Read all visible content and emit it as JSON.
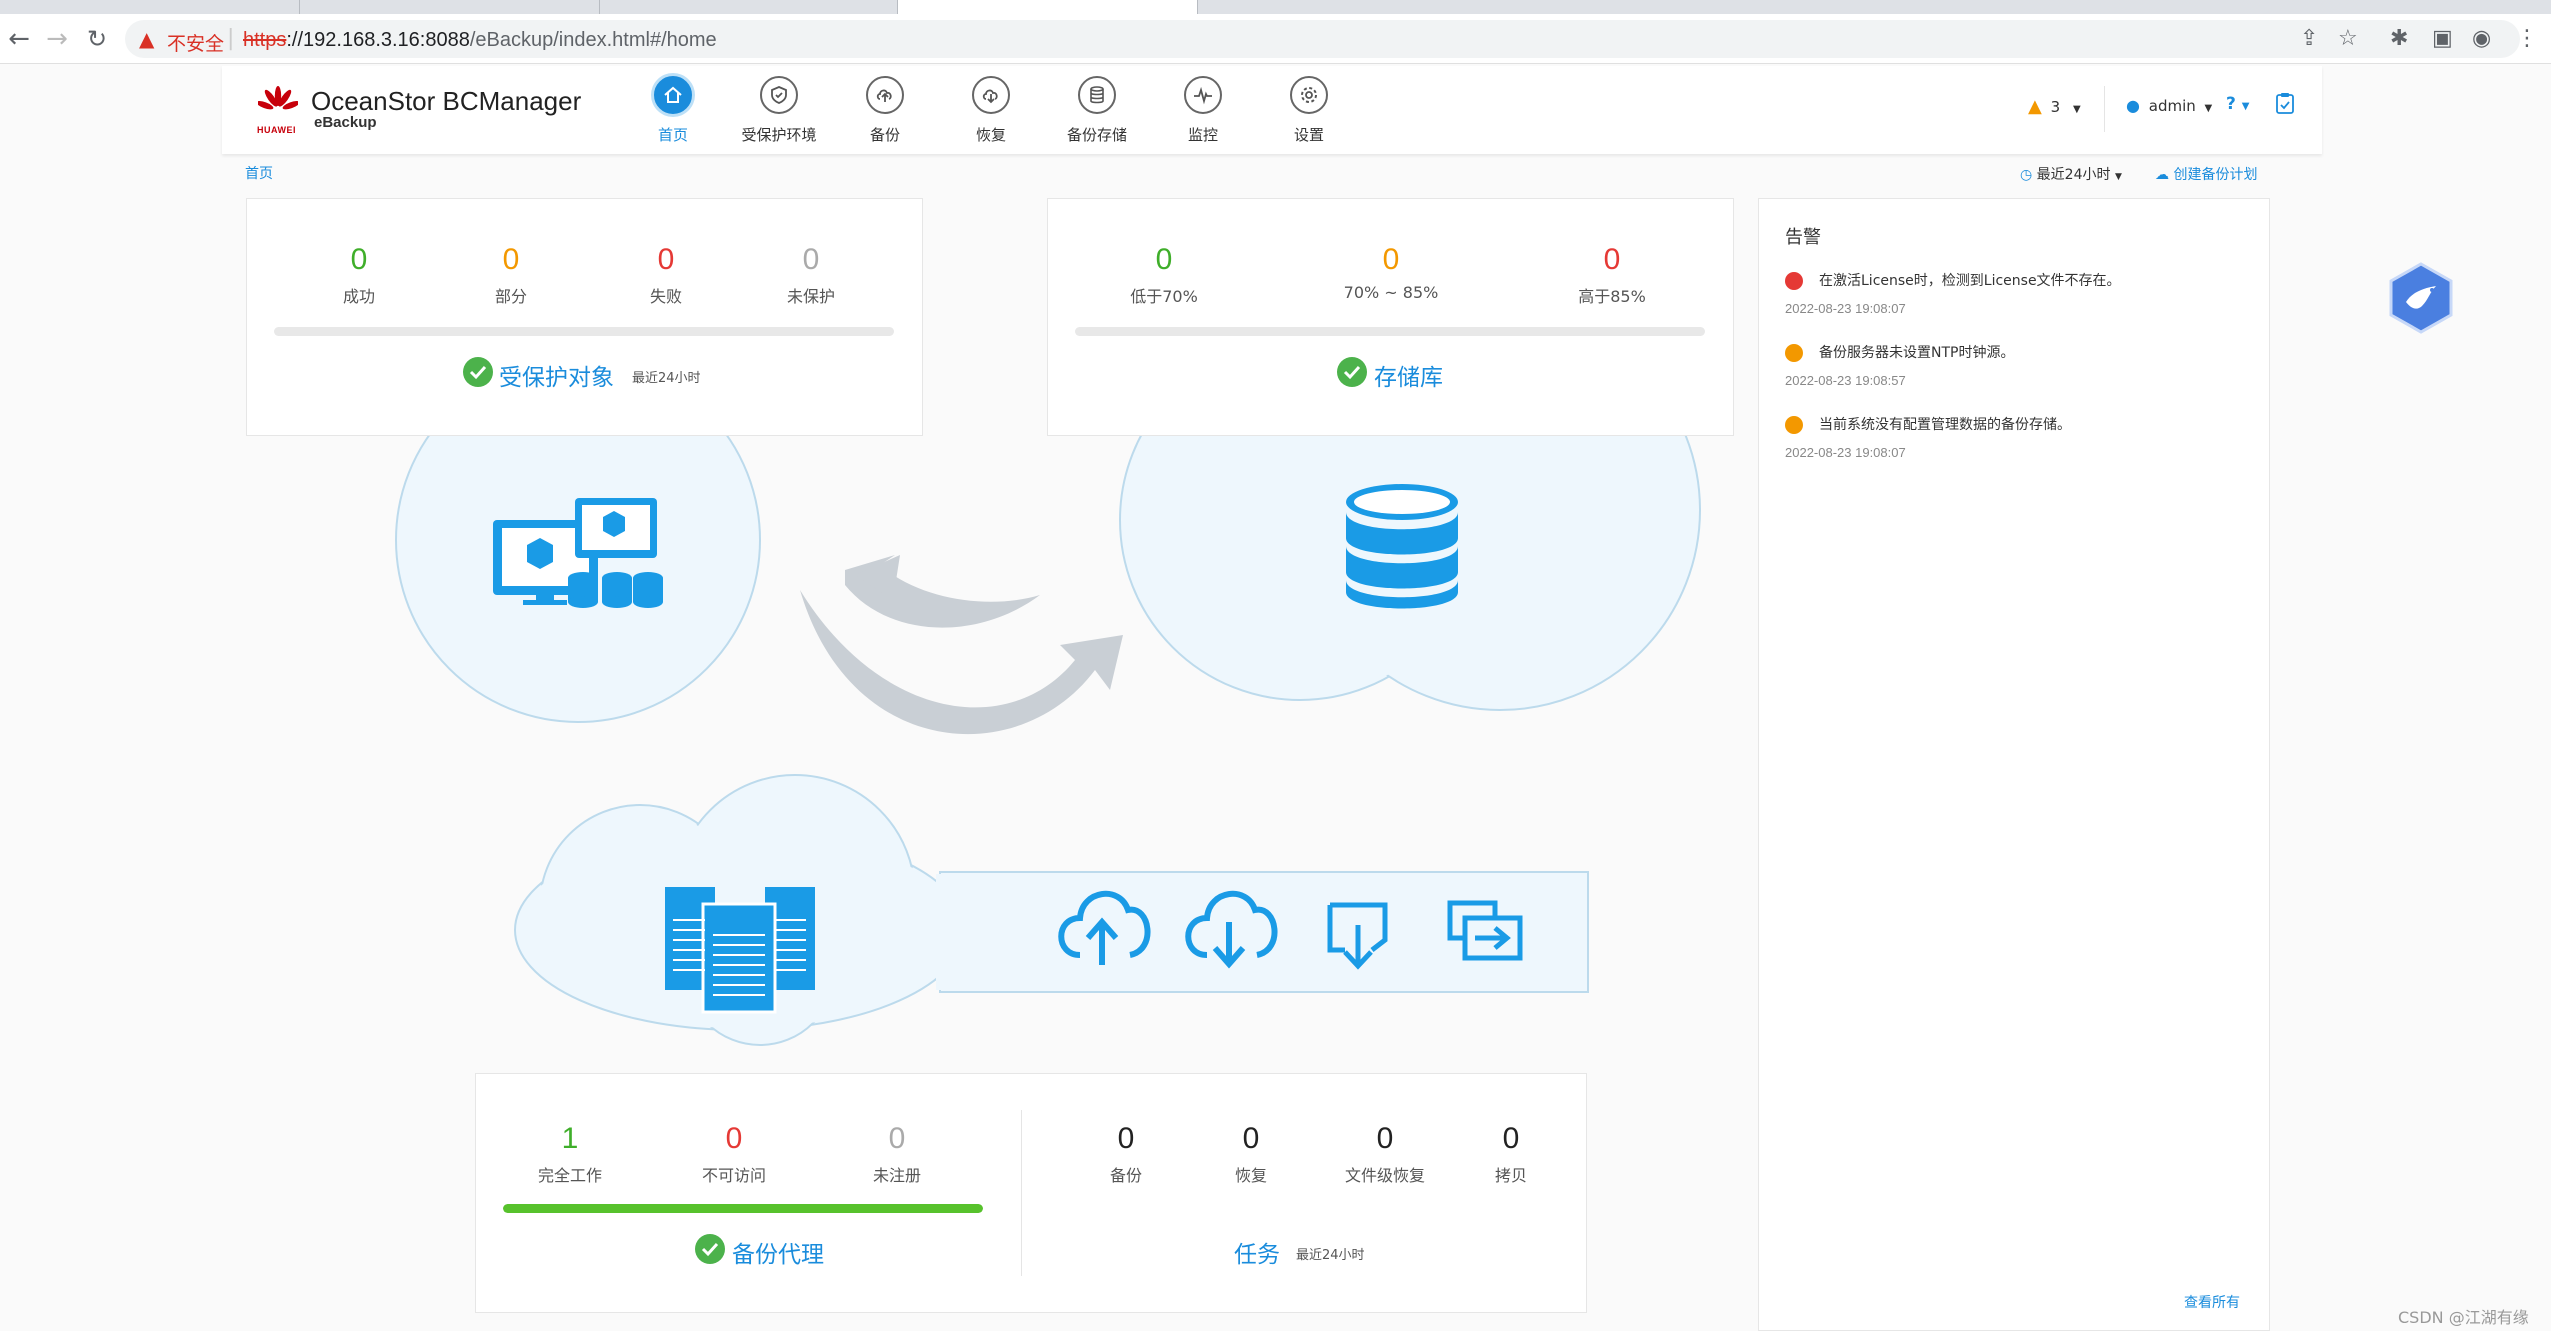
{
  "browser": {
    "insecure_label": "不安全",
    "url_scheme": "https",
    "url_host": "://192.168.3.16:8088",
    "url_path": "/eBackup/index.html#/home"
  },
  "app": {
    "brand": "HUAWEI",
    "title": "OceanStor BCManager",
    "subtitle": "eBackup"
  },
  "nav": [
    {
      "label": "首页",
      "icon": "home-icon",
      "active": true
    },
    {
      "label": "受保护环境",
      "icon": "shield-icon",
      "active": false
    },
    {
      "label": "备份",
      "icon": "cloud-upload-icon",
      "active": false
    },
    {
      "label": "恢复",
      "icon": "cloud-download-icon",
      "active": false
    },
    {
      "label": "备份存储",
      "icon": "database-icon",
      "active": false
    },
    {
      "label": "监控",
      "icon": "pulse-icon",
      "active": false
    },
    {
      "label": "设置",
      "icon": "gear-icon",
      "active": false
    }
  ],
  "header_right": {
    "alarm_count": "3",
    "user": "admin",
    "help": "?"
  },
  "breadcrumb": "首页",
  "time_filter": "最近24小时",
  "create_plan": "创建备份计划",
  "protected": {
    "stats": [
      {
        "value": "0",
        "label": "成功",
        "color": "#3fae2a"
      },
      {
        "value": "0",
        "label": "部分",
        "color": "#f39800"
      },
      {
        "value": "0",
        "label": "失败",
        "color": "#e53935"
      },
      {
        "value": "0",
        "label": "未保护",
        "color": "#aaaaaa"
      }
    ],
    "title": "受保护对象",
    "sub": "最近24小时",
    "progress": 0
  },
  "storage": {
    "stats": [
      {
        "value": "0",
        "label": "低于70%",
        "color": "#3fae2a"
      },
      {
        "value": "0",
        "label": "70% ~ 85%",
        "color": "#f39800"
      },
      {
        "value": "0",
        "label": "高于85%",
        "color": "#e53935"
      }
    ],
    "title": "存储库",
    "progress": 0
  },
  "proxy": {
    "stats": [
      {
        "value": "1",
        "label": "完全工作",
        "color": "#3fae2a"
      },
      {
        "value": "0",
        "label": "不可访问",
        "color": "#e53935"
      },
      {
        "value": "0",
        "label": "未注册",
        "color": "#aaaaaa"
      }
    ],
    "title": "备份代理",
    "progress": 100
  },
  "tasks": {
    "stats": [
      {
        "value": "0",
        "label": "备份"
      },
      {
        "value": "0",
        "label": "恢复"
      },
      {
        "value": "0",
        "label": "文件级恢复"
      },
      {
        "value": "0",
        "label": "拷贝"
      }
    ],
    "title": "任务",
    "sub": "最近24小时"
  },
  "alerts": {
    "title": "告警",
    "items": [
      {
        "text": "在激活License时，检测到License文件不存在。",
        "time": "2022-08-23 19:08:07",
        "level": "critical",
        "color": "#e53935"
      },
      {
        "text": "备份服务器未设置NTP时钟源。",
        "time": "2022-08-23 19:08:57",
        "level": "major",
        "color": "#f39800"
      },
      {
        "text": "当前系统没有配置管理数据的备份存储。",
        "time": "2022-08-23 19:08:07",
        "level": "major",
        "color": "#f39800"
      }
    ],
    "view_all": "查看所有"
  },
  "watermark": "CSDN @江湖有缘"
}
